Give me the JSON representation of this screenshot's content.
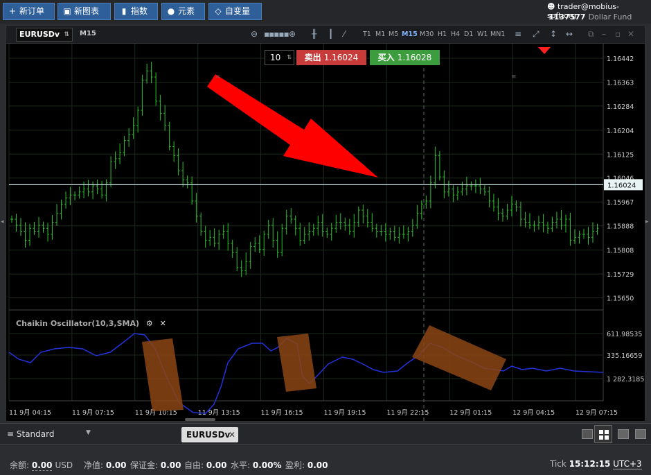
{
  "toolbar": {
    "new_order": "新订单",
    "new_chart": "新图表",
    "indicators": "指数",
    "elements": "元素",
    "variables": "自变量"
  },
  "account": {
    "user": "trader@mobius-soft.org",
    "id": "1137577",
    "fund": "Dollar Fund"
  },
  "chart_window": {
    "symbol": "EURUSDv",
    "timeframe_label": "M15",
    "timeframes": [
      "T1",
      "M1",
      "M5",
      "M15",
      "M30",
      "H1",
      "H4",
      "D1",
      "W1",
      "MN1"
    ],
    "selected_timeframe": "M15"
  },
  "trade_panel": {
    "quantity": "10",
    "sell_label": "卖出",
    "sell_price": "1.16024",
    "buy_label": "买入",
    "buy_price": "1.16028"
  },
  "oscillator": {
    "label": "Chaikin Oscillator(10,3,SMA)",
    "levels": [
      "611.98535",
      "335.16659",
      "1 282.3185"
    ]
  },
  "chart_data": {
    "type": "candlestick",
    "price_axis_ticks": [
      "1.16442",
      "1.16363",
      "1.16284",
      "1.16204",
      "1.16125",
      "1.16046",
      "1.15967",
      "1.15888",
      "1.15808",
      "1.15729",
      "1.15650"
    ],
    "current_price": "1.16024",
    "time_axis_ticks": [
      "11 9月 04:15",
      "11 9月 07:15",
      "11 9月 10:15",
      "11 9月 13:15",
      "11 9月 16:15",
      "11 9月 19:15",
      "11 9月 22:15",
      "12 9月 01:15",
      "12 9月 04:15",
      "12 9月 07:15"
    ],
    "ylim": [
      1.1561,
      1.1649
    ],
    "close_prices": [
      1.1591,
      1.1589,
      1.1587,
      1.1584,
      1.1588,
      1.1587,
      1.1589,
      1.1588,
      1.1586,
      1.159,
      1.1593,
      1.1596,
      1.1598,
      1.1599,
      1.1599,
      1.16,
      1.1601,
      1.16,
      1.1602,
      1.1601,
      1.1599,
      1.1603,
      1.161,
      1.1611,
      1.1613,
      1.1617,
      1.1619,
      1.1622,
      1.1627,
      1.1637,
      1.164,
      1.1638,
      1.163,
      1.1626,
      1.1622,
      1.1615,
      1.1612,
      1.1607,
      1.1604,
      1.1603,
      1.1597,
      1.1592,
      1.1587,
      1.1584,
      1.1585,
      1.1583,
      1.1586,
      1.1587,
      1.1583,
      1.158,
      1.1575,
      1.1574,
      1.1577,
      1.1582,
      1.1583,
      1.1581,
      1.1586,
      1.1589,
      1.1584,
      1.158,
      1.1588,
      1.1592,
      1.1591,
      1.1588,
      1.1584,
      1.1586,
      1.1587,
      1.1588,
      1.159,
      1.1587,
      1.1586,
      1.1588,
      1.159,
      1.159,
      1.1589,
      1.1587,
      1.159,
      1.1594,
      1.1592,
      1.159,
      1.1588,
      1.1587,
      1.1587,
      1.1586,
      1.1587,
      1.1585,
      1.1586,
      1.1586,
      1.1587,
      1.1589,
      1.1593,
      1.1596,
      1.1597,
      1.1603,
      1.1612,
      1.1605,
      1.16,
      1.1601,
      1.1599,
      1.16,
      1.1601,
      1.1602,
      1.1602,
      1.1602,
      1.1601,
      1.16,
      1.1597,
      1.1595,
      1.1593,
      1.1592,
      1.1594,
      1.1596,
      1.1595,
      1.1591,
      1.159,
      1.1589,
      1.1589,
      1.159,
      1.1589,
      1.1588,
      1.159,
      1.1591,
      1.1589,
      1.1591,
      1.1584,
      1.1585,
      1.1586,
      1.1586,
      1.1585,
      1.1587,
      1.1588
    ]
  },
  "tabs_bar": {
    "profile": "Standard",
    "chart_tab": "EURUSDv"
  },
  "status": {
    "balance_label": "余额:",
    "balance": "0.00",
    "currency": "USD",
    "equity_label": "净值:",
    "equity": "0.00",
    "margin_label": "保证金:",
    "margin": "0.00",
    "free_label": "自由:",
    "free": "0.00",
    "level_label": "水平:",
    "level": "0.00%",
    "profit_label": "盈利:",
    "profit": "0.00",
    "tick_label": "Tick",
    "time": "15:12:15",
    "tz": "UTC+3"
  }
}
